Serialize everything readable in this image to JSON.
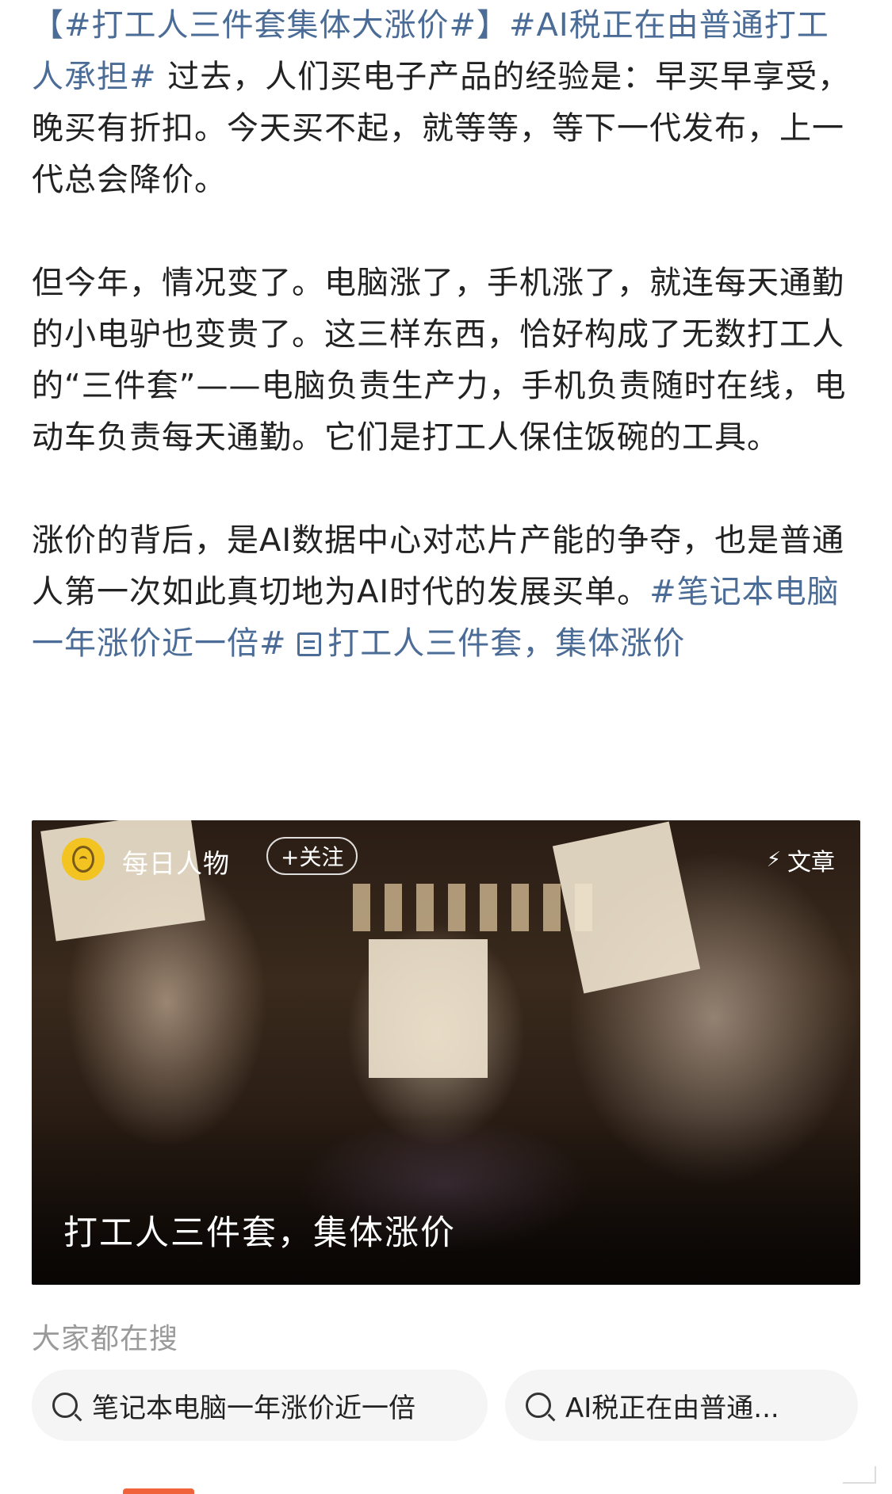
{
  "post": {
    "tag_1": "【#打工人三件套集体大涨价#】",
    "tag_2": "#AI税正在由普通打工人承担#",
    "p1_rest": " 过去，人们买电子产品的经验是：早买早享受，晚买有折扣。今天买不起，就等等，等下一代发布，上一代总会降价。",
    "p2": "但今年，情况变了。电脑涨了，手机涨了，就连每天通勤的小电驴也变贵了。这三样东西，恰好构成了无数打工人的“三件套”——电脑负责生产力，手机负责随时在线，电动车负责每天通勤。它们是打工人保住饭碗的工具。",
    "p3_text": "涨价的背后，是AI数据中心对芯片产能的争夺，也是普通人第一次如此真切地为AI时代的发展买单。",
    "p3_tag": "#笔记本电脑一年涨价近一倍#",
    "p3_link": "打工人三件套，集体涨价"
  },
  "card": {
    "author_name": "每日人物",
    "follow_label": "+关注",
    "type_label": "文章",
    "title": "打工人三件套，集体涨价"
  },
  "search": {
    "heading": "大家都在搜",
    "chips": [
      "笔记本电脑一年涨价近一倍",
      "AI税正在由普通..."
    ]
  }
}
